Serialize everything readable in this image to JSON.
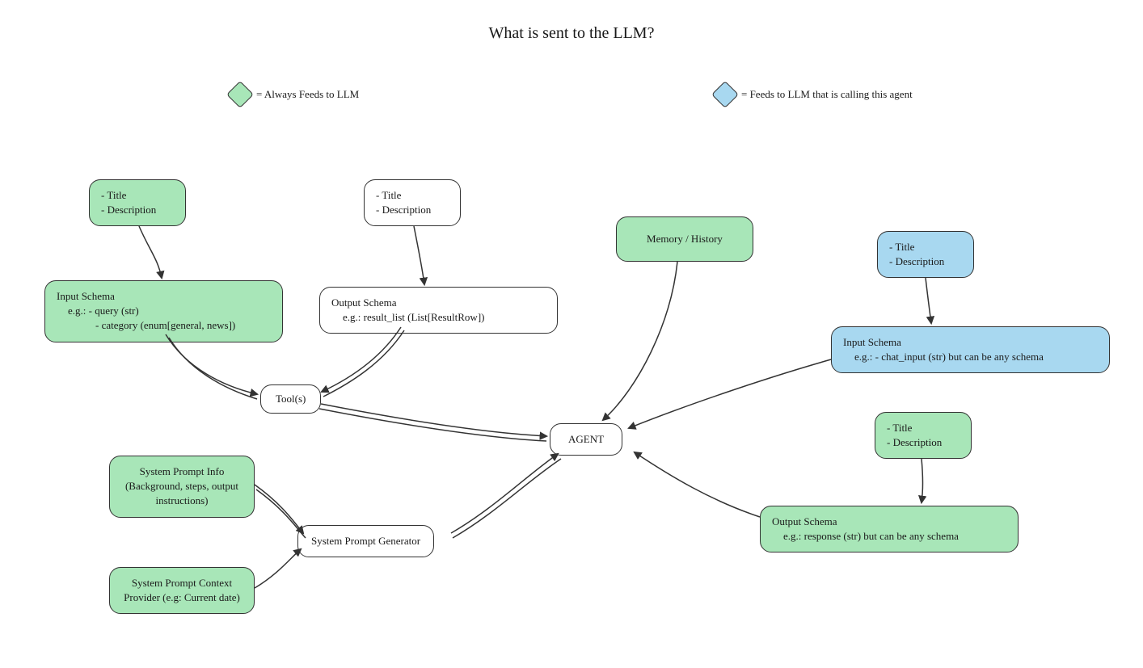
{
  "title": "What is sent to the LLM?",
  "legend": {
    "green": "= Always Feeds to LLM",
    "blue": "= Feeds to LLM that is calling this agent"
  },
  "boxes": {
    "tool_title_green": {
      "line1": "- Title",
      "line2": "- Description"
    },
    "tool_title_white": {
      "line1": "- Title",
      "line2": "- Description"
    },
    "input_schema_green": {
      "l1": "Input Schema",
      "l2": "e.g.: - query (str)",
      "l3": "- category (enum[general, news])"
    },
    "output_schema_white": {
      "l1": "Output Schema",
      "l2": "e.g.: result_list (List[ResultRow])"
    },
    "tools": "Tool(s)",
    "memory": "Memory / History",
    "agent_title_blue": {
      "line1": "- Title",
      "line2": "- Description"
    },
    "input_schema_blue": {
      "l1": "Input Schema",
      "l2": "e.g.: - chat_input (str) but can be any schema"
    },
    "agent": "AGENT",
    "agent_title_green": {
      "line1": "- Title",
      "line2": "- Description"
    },
    "output_schema_green": {
      "l1": "Output Schema",
      "l2": "e.g.: response (str) but can be any schema"
    },
    "sys_prompt_info": "System Prompt Info (Background, steps, output instructions)",
    "sys_prompt_context": "System Prompt Context Provider (e.g: Current date)",
    "sys_prompt_gen": "System Prompt Generator"
  },
  "colors": {
    "green": "#a8e6b8",
    "blue": "#a8d8f0",
    "stroke": "#333333"
  }
}
